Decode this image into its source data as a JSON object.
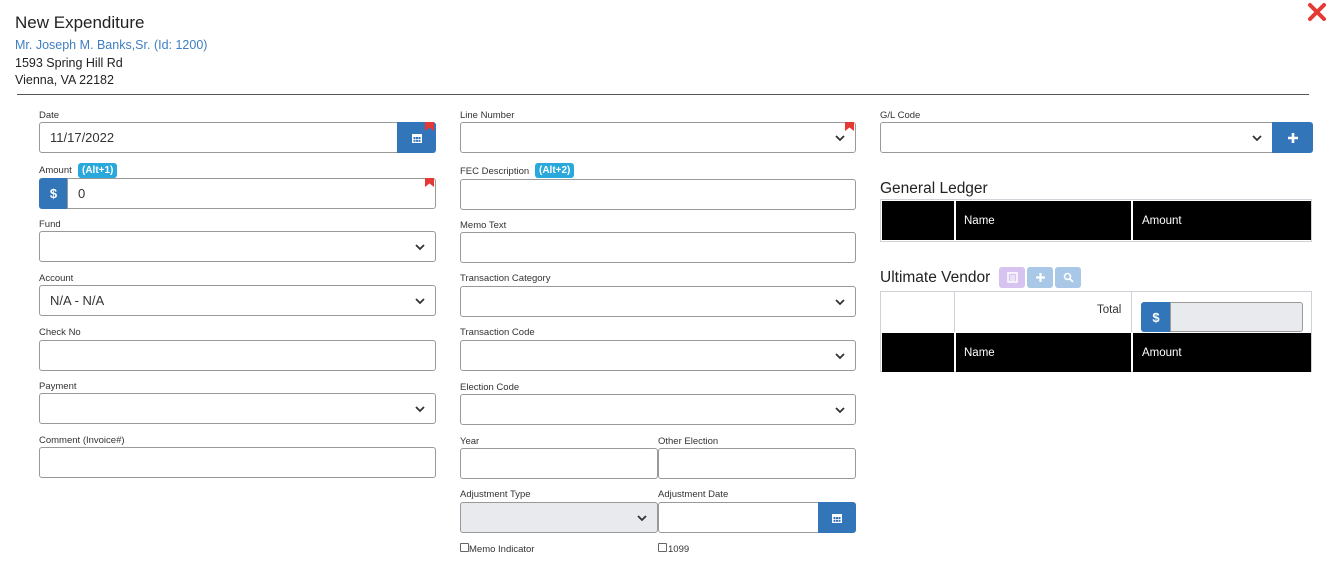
{
  "header": {
    "title": "New Expenditure",
    "person": "Mr. Joseph M. Banks,Sr. (Id: 1200)",
    "address_line1": "1593 Spring Hill Rd",
    "address_line2": "Vienna, VA 22182"
  },
  "col1": {
    "date_label": "Date",
    "date_value": "11/17/2022",
    "amount_label": "Amount",
    "amount_shortcut": "(Alt+1)",
    "amount_prefix": "$",
    "amount_value": "0",
    "fund_label": "Fund",
    "fund_value": "",
    "account_label": "Account",
    "account_value": "N/A - N/A",
    "check_label": "Check No",
    "check_value": "",
    "payment_label": "Payment",
    "payment_value": "",
    "comment_label": "Comment (Invoice#)",
    "comment_value": ""
  },
  "col2": {
    "line_number_label": "Line Number",
    "fec_label": "FEC Description",
    "fec_shortcut": "(Alt+2)",
    "memo_text_label": "Memo Text",
    "transaction_category_label": "Transaction Category",
    "transaction_code_label": "Transaction Code",
    "election_code_label": "Election Code",
    "year_label": "Year",
    "other_election_label": "Other Election",
    "adjustment_type_label": "Adjustment Type",
    "adjustment_date_label": "Adjustment Date",
    "memo_indicator_label": "Memo Indicator",
    "form_1099_label": "1099"
  },
  "col3": {
    "gl_code_label": "G/L Code",
    "general_ledger_title": "General Ledger",
    "gl_columns": [
      "Name",
      "Amount"
    ],
    "ultimate_vendor_title": "Ultimate Vendor",
    "total_label": "Total",
    "total_prefix": "$",
    "total_value": "",
    "uv_columns": [
      "Name",
      "Amount"
    ]
  },
  "colors": {
    "accent": "#3276b9",
    "badge": "#29a8db",
    "required_flag": "#e53935",
    "close": "#e53935"
  }
}
